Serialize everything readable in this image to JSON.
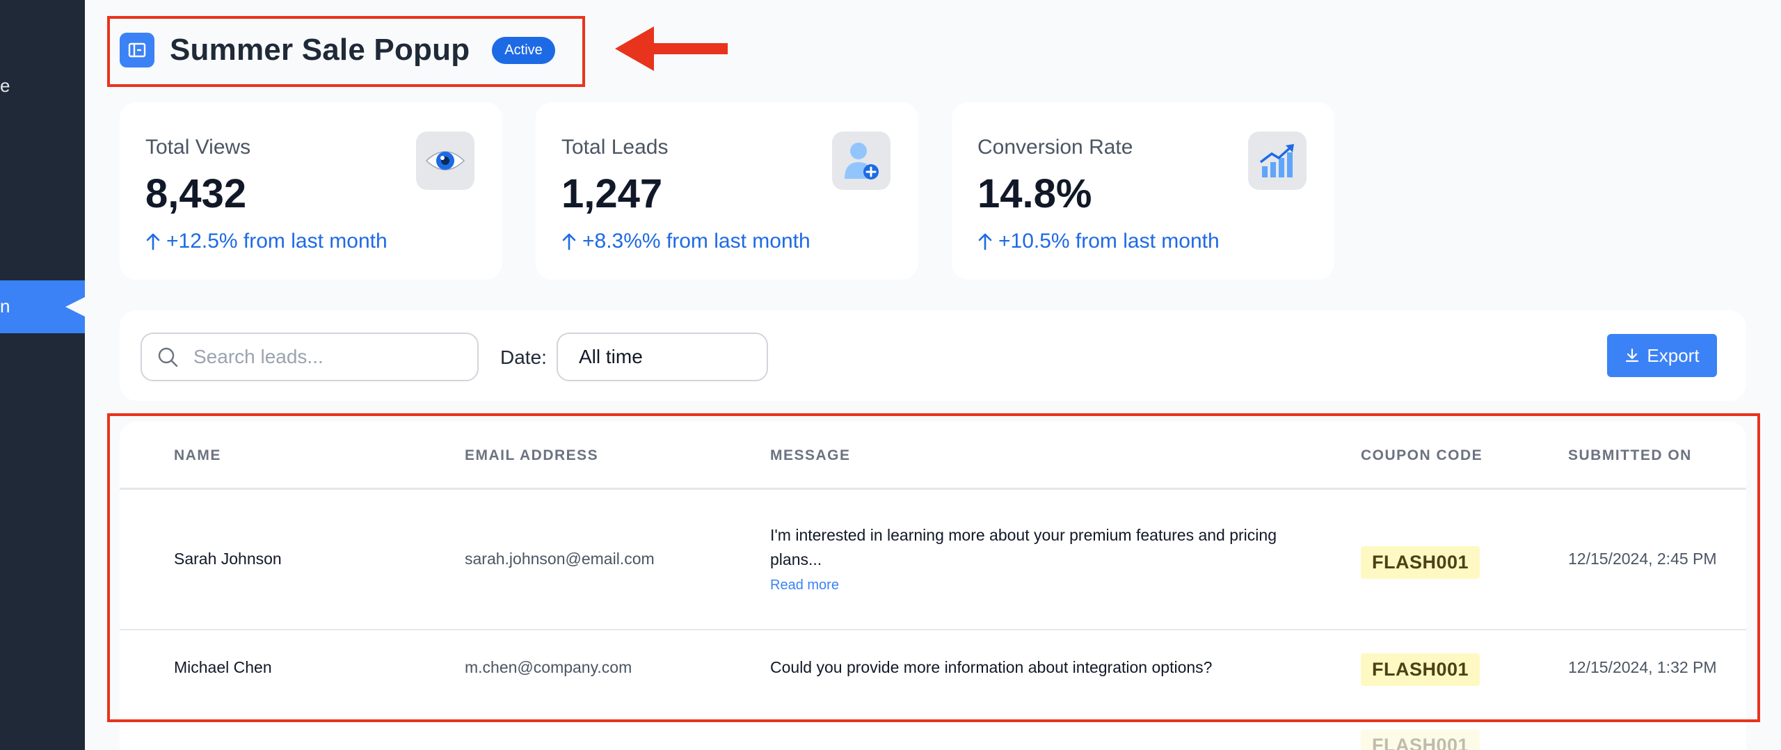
{
  "sidebar": {
    "items": [
      {
        "label": "e"
      },
      {
        "label": "n",
        "active": true
      }
    ]
  },
  "header": {
    "title": "Summer Sale Popup",
    "status": "Active"
  },
  "stats": [
    {
      "label": "Total Views",
      "value": "8,432",
      "change": "+12.5% from last month",
      "icon": "eye-icon"
    },
    {
      "label": "Total Leads",
      "value": "1,247",
      "change": "+8.3%% from last month",
      "icon": "user-add-icon"
    },
    {
      "label": "Conversion Rate",
      "value": "14.8%",
      "change": "+10.5% from last month",
      "icon": "chart-up-icon"
    }
  ],
  "filters": {
    "search_placeholder": "Search leads...",
    "date_label": "Date:",
    "date_value": "All time",
    "export_label": "Export"
  },
  "table": {
    "columns": [
      "NAME",
      "EMAIL ADDRESS",
      "MESSAGE",
      "COUPON CODE",
      "SUBMITTED ON"
    ],
    "rows": [
      {
        "name": "Sarah Johnson",
        "email": "sarah.johnson@email.com",
        "message": "I'm interested in learning more about your premium features and pricing plans...",
        "read_more": "Read more",
        "coupon": "FLASH001",
        "submitted": "12/15/2024, 2:45 PM"
      },
      {
        "name": "Michael Chen",
        "email": "m.chen@company.com",
        "message": "Could you provide more information about integration options?",
        "coupon": "FLASH001",
        "submitted": "12/15/2024, 1:32 PM"
      },
      {
        "coupon": "FLASH001"
      }
    ]
  },
  "colors": {
    "accent": "#3b82f6",
    "annotation": "#e8341c",
    "coupon_bg": "#fef9c3"
  }
}
